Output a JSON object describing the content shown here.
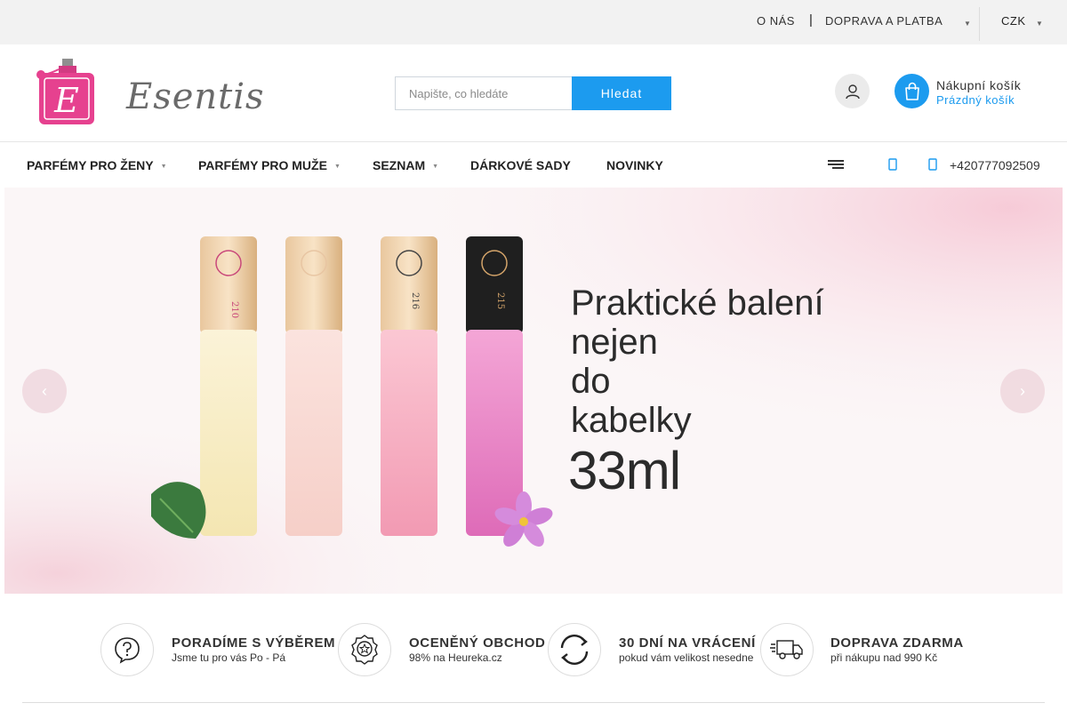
{
  "topbar": {
    "about": "O NÁS",
    "separator": "|",
    "shipping": "DOPRAVA A PLATBA",
    "currency": "CZK"
  },
  "header": {
    "logo_text": "Esentis",
    "search_placeholder": "Napište, co hledáte",
    "search_button": "Hledat",
    "cart_title": "Nákupní košík",
    "cart_status": "Prázdný košík"
  },
  "nav": {
    "items": [
      {
        "label": "PARFÉMY PRO ŽENY"
      },
      {
        "label": "PARFÉMY PRO MUŽE"
      },
      {
        "label": "SEZNAM"
      },
      {
        "label": "DÁRKOVÉ SADY"
      },
      {
        "label": "NOVINKY"
      }
    ],
    "phone": "+420777092509"
  },
  "banner": {
    "headline_lines": [
      "Praktické balení",
      "nejen",
      "do",
      "kabelky"
    ],
    "volume": "33ml",
    "bottle_labels": [
      "210",
      "",
      "216",
      "215"
    ]
  },
  "features": [
    {
      "title": "PORADÍME S VÝBĚREM",
      "subtitle": "Jsme tu pro vás Po - Pá",
      "icon": "question-bubble-icon"
    },
    {
      "title": "OCENĚNÝ OBCHOD",
      "subtitle": "98% na Heureka.cz",
      "icon": "award-badge-icon"
    },
    {
      "title": "30 DNÍ NA VRÁCENÍ",
      "subtitle": "pokud vám velikost nesedne",
      "icon": "return-arrows-icon"
    },
    {
      "title": "DOPRAVA ZDARMA",
      "subtitle": "při nákupu nad 990 Kč",
      "icon": "delivery-truck-icon"
    }
  ],
  "colors": {
    "accent": "#1c9bef",
    "logo_pink": "#e6418f",
    "topbar_bg": "#f2f2f2"
  }
}
